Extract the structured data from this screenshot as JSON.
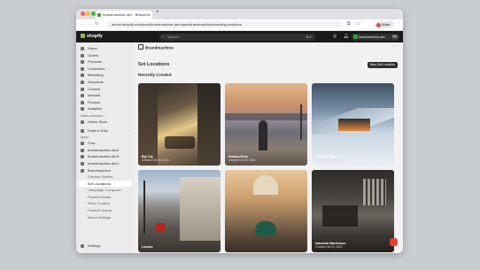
{
  "browser": {
    "tab_title": "brandmachine-dev · Brandm...",
    "url": "admin.shopify.com/store/brandmachine-dev/apps/brandmachine/shooting-locations",
    "profile_label": "Work"
  },
  "topbar": {
    "logo_text": "shopify",
    "search_placeholder": "Search",
    "search_shortcut": "⌘ K",
    "store_name": "brandmachine-dev",
    "store_badge": "BM"
  },
  "sidebar": {
    "items": [
      {
        "label": "Home"
      },
      {
        "label": "Orders"
      },
      {
        "label": "Products"
      },
      {
        "label": "Customers"
      },
      {
        "label": "Marketing"
      },
      {
        "label": "Discounts"
      },
      {
        "label": "Content"
      },
      {
        "label": "Markets"
      },
      {
        "label": "Finance"
      },
      {
        "label": "Analytics"
      }
    ],
    "sales_channels_heading": "Sales channels ›",
    "online_store": "Online Store",
    "point_of_sale": "Point of Sale",
    "apps_heading": "Apps ›",
    "apps": [
      {
        "label": "Flow"
      },
      {
        "label": "brandmachine-dev2"
      },
      {
        "label": "brandmachine-dev3"
      },
      {
        "label": "brandmachine-dev1"
      },
      {
        "label": "Brandmachine"
      }
    ],
    "app_subitems": [
      {
        "label": "Fashion Models"
      },
      {
        "label": "Set Locations"
      },
      {
        "label": "Campaign Composer"
      },
      {
        "label": "Product Studio"
      },
      {
        "label": "Store Content"
      },
      {
        "label": "Product Videos"
      },
      {
        "label": "Brand Settings"
      }
    ],
    "settings": "Settings"
  },
  "main": {
    "app_title": "Brandmachine",
    "page_title": "Set Locations",
    "new_button": "New Set Location",
    "section_title": "Recently Created",
    "cards": [
      {
        "title": "Big City",
        "date": "Created Oct 24, 2024"
      },
      {
        "title": "Hudson River",
        "date": "Created Oct 25, 2024"
      },
      {
        "title": "Mountain Top",
        "date": "Created Oct 25, 2024"
      },
      {
        "title": "London",
        "date": ""
      },
      {
        "title": "",
        "date": ""
      },
      {
        "title": "Industrial Warehouse",
        "date": "Created Oct 24, 2024"
      }
    ]
  },
  "colors": {
    "shopify_bar": "#1a1a1a",
    "sidebar_bg": "#ebebeb",
    "main_bg": "#f1f1f1",
    "primary_button": "#303030",
    "chat_button": "#e4422f"
  }
}
